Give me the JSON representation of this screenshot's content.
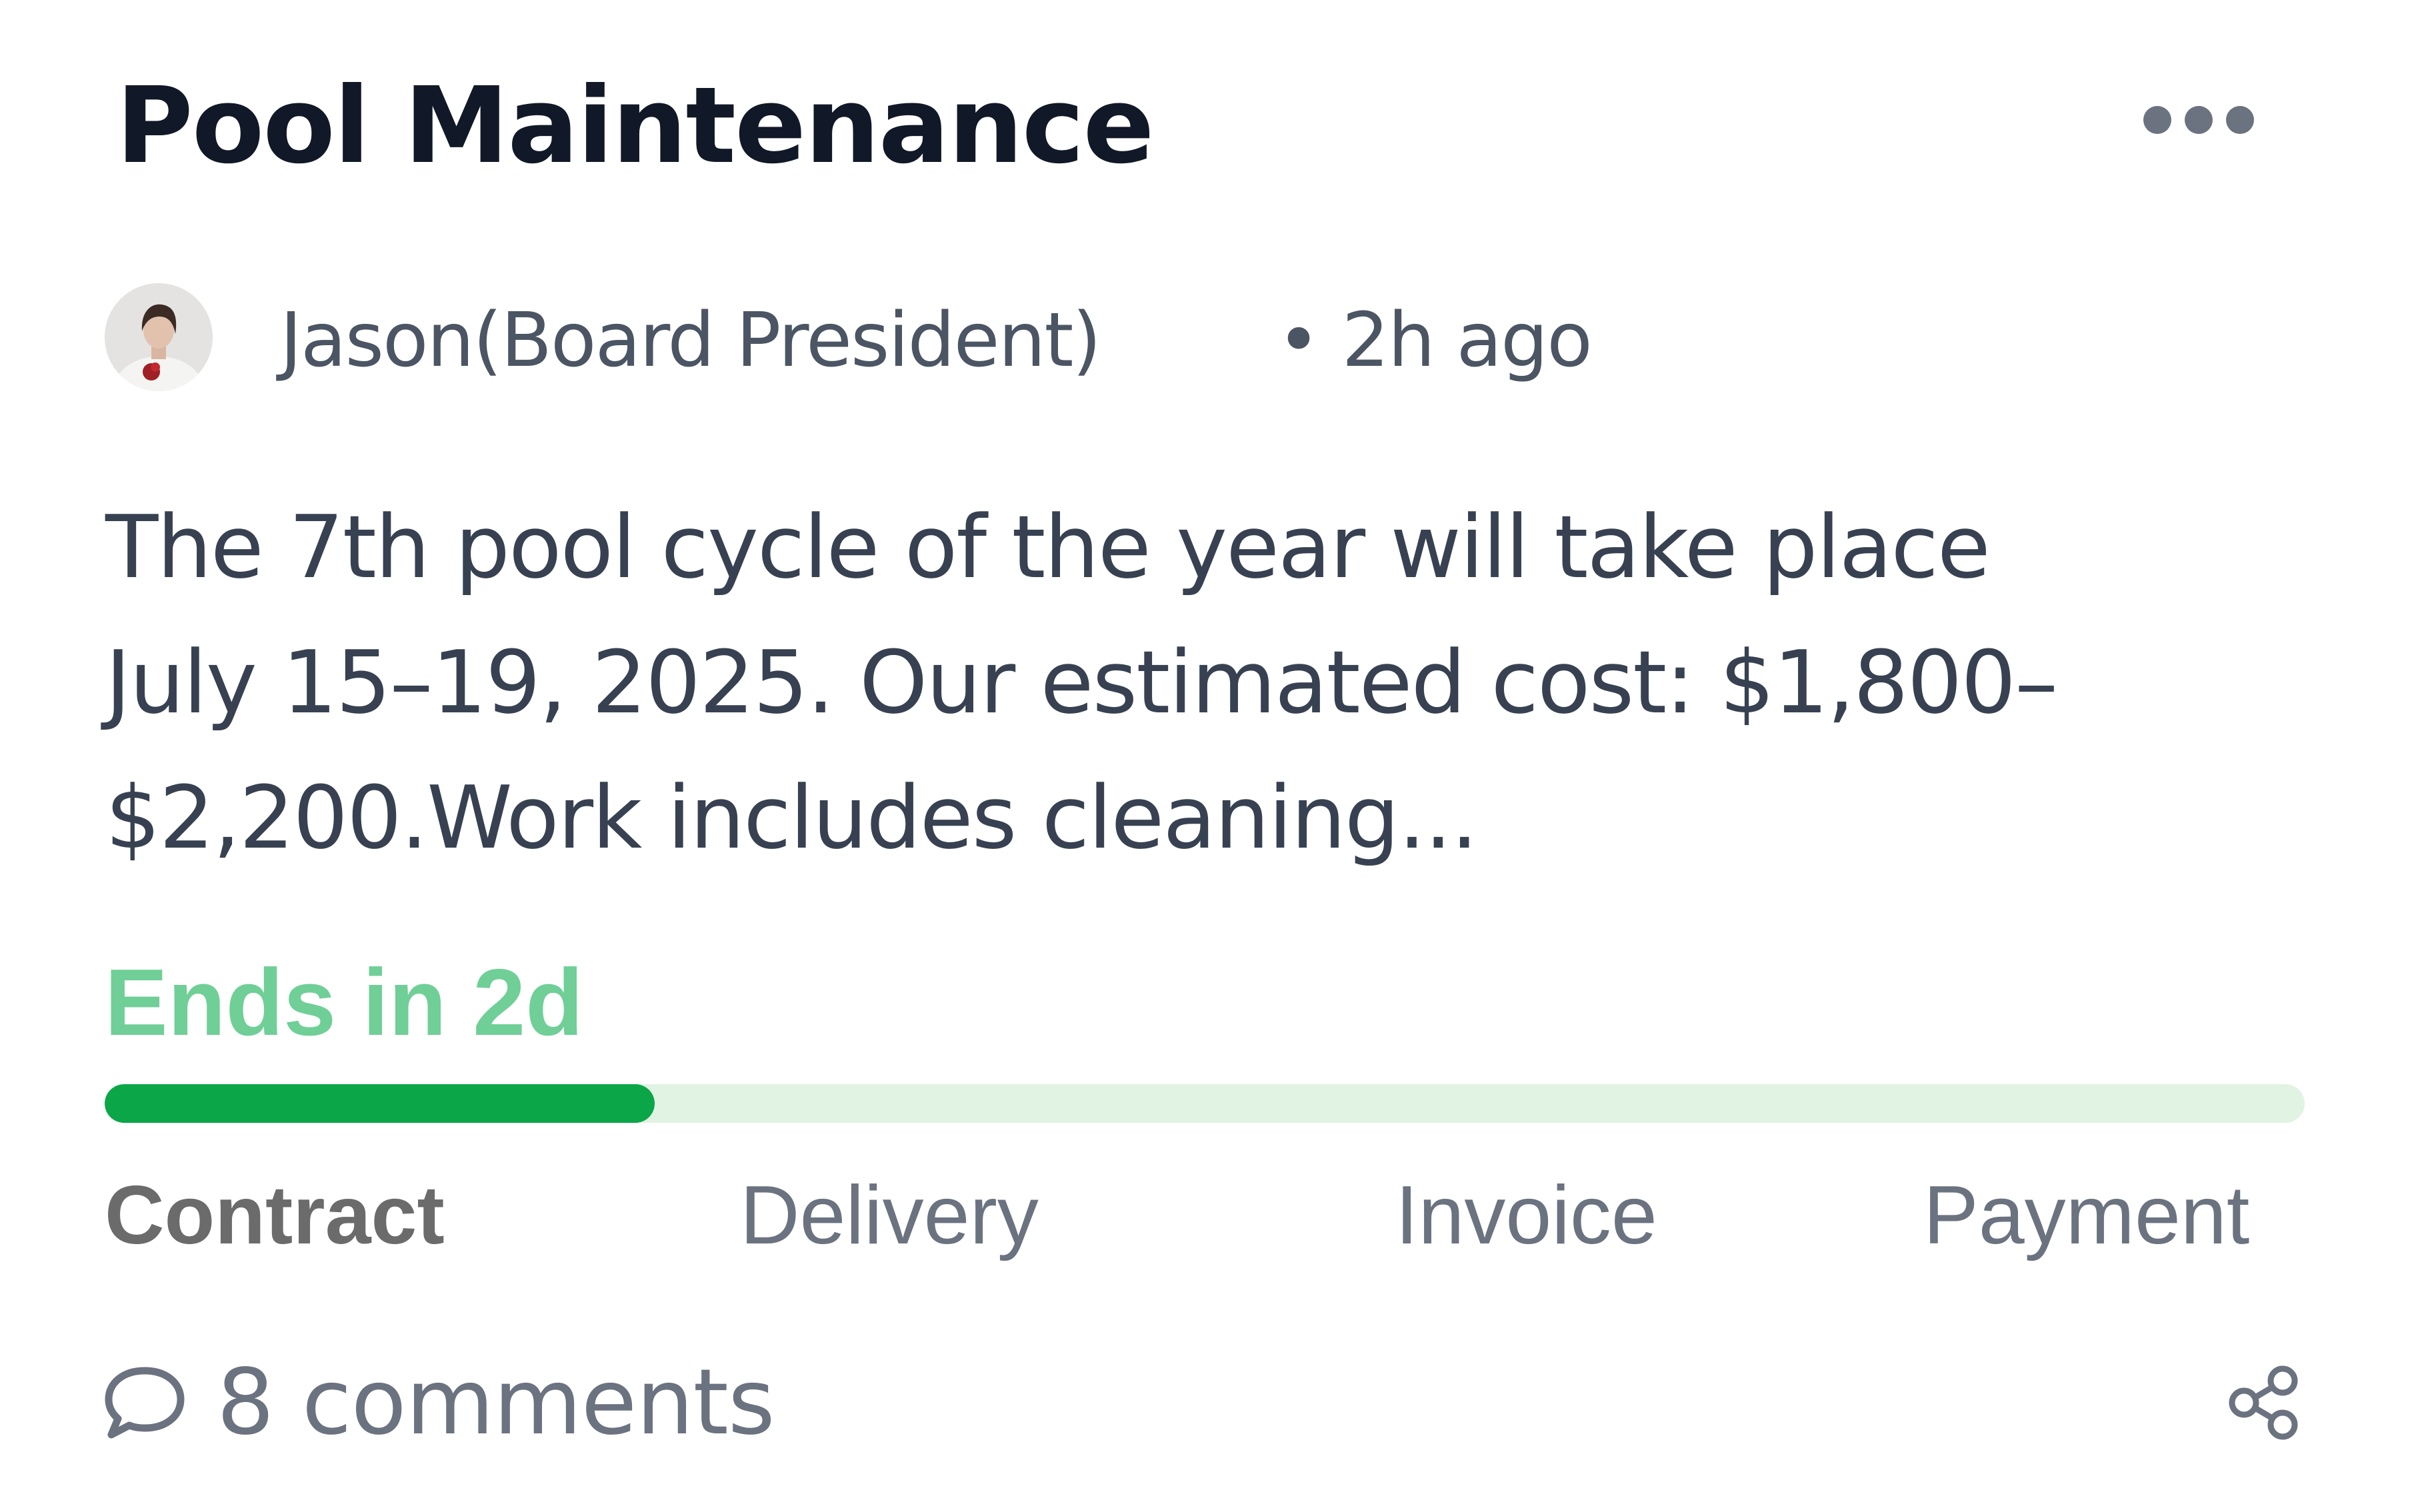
{
  "post": {
    "title": "Pool Maintenance",
    "author": "Jason(Board President)",
    "time": "• 2h ago",
    "body_lines": [
      "The 7th pool  cycle of the year will take place",
      "July 15–19, 2025. Our estimated cost: $1,800–",
      "$2,200.Work includes cleaning..."
    ],
    "menu_icon": "more-horizontal-icon"
  },
  "status": {
    "ends_label": "Ends in 2d",
    "progress": 0.25,
    "progress_fill_color": "#0aa648",
    "progress_track_color": "#e1f3e2",
    "ends_color": "#6fcf97",
    "stages": [
      "Contract",
      "Delivery",
      "Invoice",
      "Payment"
    ],
    "current_stage": "Contract"
  },
  "footer": {
    "comments_label": "8 comments",
    "comments_icon": "comment-bubble-icon",
    "share_icon": "share-icon"
  }
}
